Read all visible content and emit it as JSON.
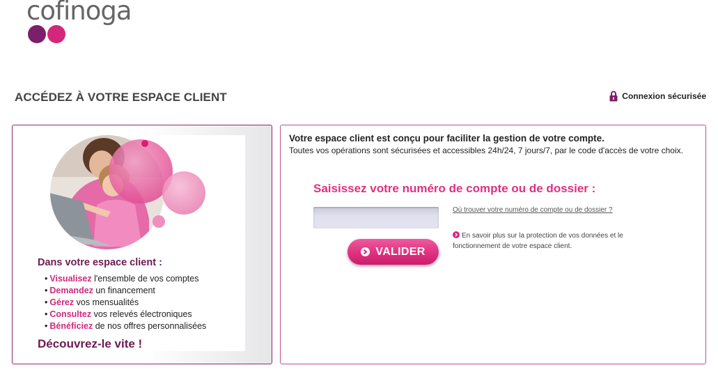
{
  "brand": {
    "name": "cofinoga",
    "colors": {
      "purple": "#7b1f6a",
      "pink": "#d4267a",
      "text_gray": "#666666"
    }
  },
  "header": {
    "title": "ACCÉDEZ À VOTRE ESPACE CLIENT",
    "secure_label": "Connexion sécurisée",
    "secure_icon": "lock-icon"
  },
  "left_panel": {
    "image": "mother-daughter-laptop-photo",
    "subtitle": "Dans votre espace client :",
    "items": [
      {
        "verb": "Visualisez",
        "rest": " l'ensemble de vos comptes"
      },
      {
        "verb": "Demandez",
        "rest": " un financement"
      },
      {
        "verb": "Gérez",
        "rest": " vos mensualités"
      },
      {
        "verb": "Consultez",
        "rest": " vos relevés électroniques"
      },
      {
        "verb": "Bénéficiez",
        "rest": " de nos offres personnalisées"
      }
    ],
    "cta": "Découvrez-le vite !"
  },
  "right_panel": {
    "intro_strong": "Votre espace client est conçu pour faciliter la gestion de votre compte.",
    "intro_text": "Toutes vos opérations sont sécurisées et accessibles 24h/24, 7 jours/7, par le code d'accès de votre choix.",
    "form_heading": "Saisissez votre numéro de compte ou de dossier :",
    "input_value": "",
    "button_label": "VALIDER",
    "help_link": "Où trouver votre numéro de compte ou de dossier ?",
    "info_text": "En savoir plus sur la protection de vos données et le fonctionnement de votre espace client."
  }
}
